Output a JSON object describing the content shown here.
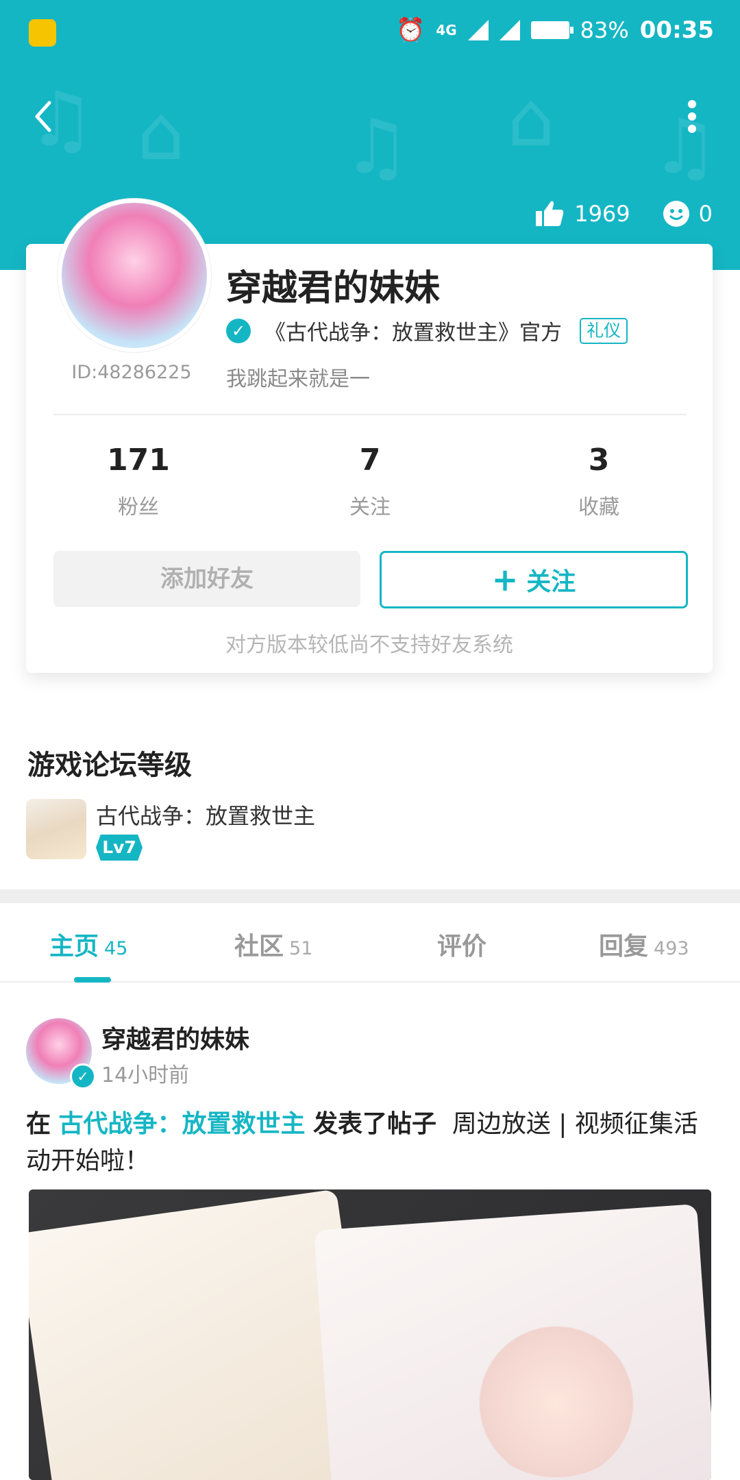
{
  "status_bar": {
    "battery_percent": "83%",
    "time": "00:35",
    "network": "4G"
  },
  "header": {
    "like_count": "1969",
    "smile_count": "0"
  },
  "profile": {
    "name": "穿越君的妹妹",
    "id": "ID:48286225",
    "verification": "《古代战争：放置救世主》官方",
    "tag": "礼仪",
    "signature": "我跳起来就是一"
  },
  "stats": [
    {
      "value": "171",
      "label": "粉丝"
    },
    {
      "value": "7",
      "label": "关注"
    },
    {
      "value": "3",
      "label": "收藏"
    }
  ],
  "buttons": {
    "add_friend": "添加好友",
    "follow": "关注",
    "hint": "对方版本较低尚不支持好友系统"
  },
  "forum_level": {
    "title": "游戏论坛等级",
    "game_name": "古代战争：放置救世主",
    "level": "Lv7"
  },
  "tabs": [
    {
      "label": "主页",
      "count": "45",
      "active": true
    },
    {
      "label": "社区",
      "count": "51",
      "active": false
    },
    {
      "label": "评价",
      "count": "",
      "active": false
    },
    {
      "label": "回复",
      "count": "493",
      "active": false
    }
  ],
  "post": {
    "author": "穿越君的妹妹",
    "time": "14小时前",
    "prefix": "在",
    "game_link": "古代战争：放置救世主",
    "action": "发表了帖子",
    "title": "周边放送 | 视频征集活动开始啦！"
  },
  "colors": {
    "accent": "#15b6c4"
  }
}
